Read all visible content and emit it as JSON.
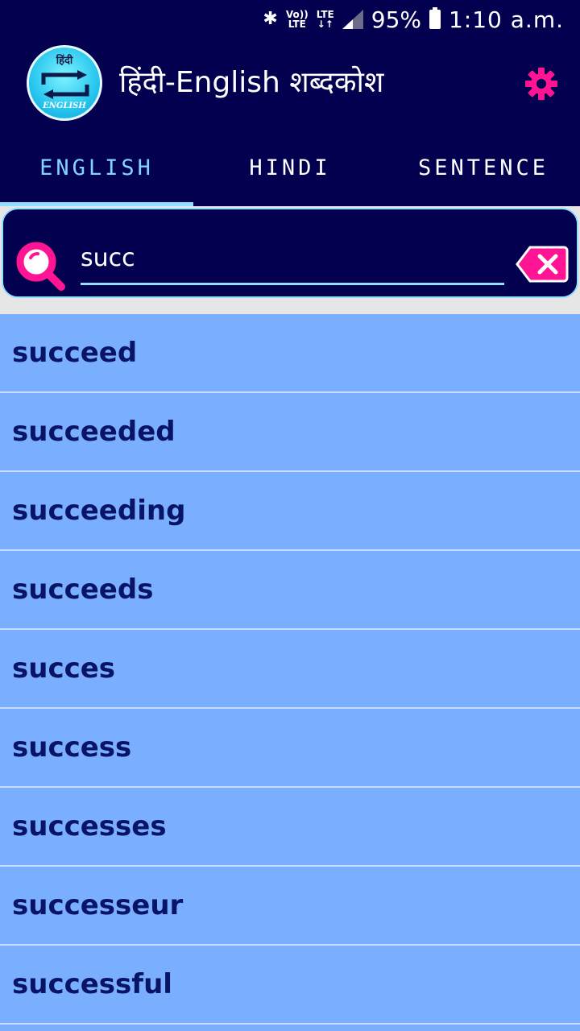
{
  "status_bar": {
    "network_label_top": "Vo))",
    "network_label_bottom": "LTE",
    "lte_top": "LTE",
    "lte_bottom": "↓↑",
    "battery": "95%",
    "time": "1:10 a.m."
  },
  "app": {
    "title": "हिंदी-English शब्दकोश",
    "logo_hindi": "हिंदी",
    "logo_english": "ENGLISH"
  },
  "tabs": [
    {
      "label": "ENGLISH",
      "active": true
    },
    {
      "label": "HINDI",
      "active": false
    },
    {
      "label": "SENTENCE",
      "active": false
    }
  ],
  "search": {
    "value": "succ",
    "placeholder": ""
  },
  "results": [
    "succeed",
    "succeeded",
    "succeeding",
    "succeeds",
    "succes",
    "success",
    "successes",
    "successeur",
    "successful"
  ],
  "colors": {
    "bar": "#03014f",
    "accent": "#8fe0ff",
    "pink": "#ff1493",
    "list_bg": "#7aaeff",
    "list_text": "#0a1466"
  }
}
